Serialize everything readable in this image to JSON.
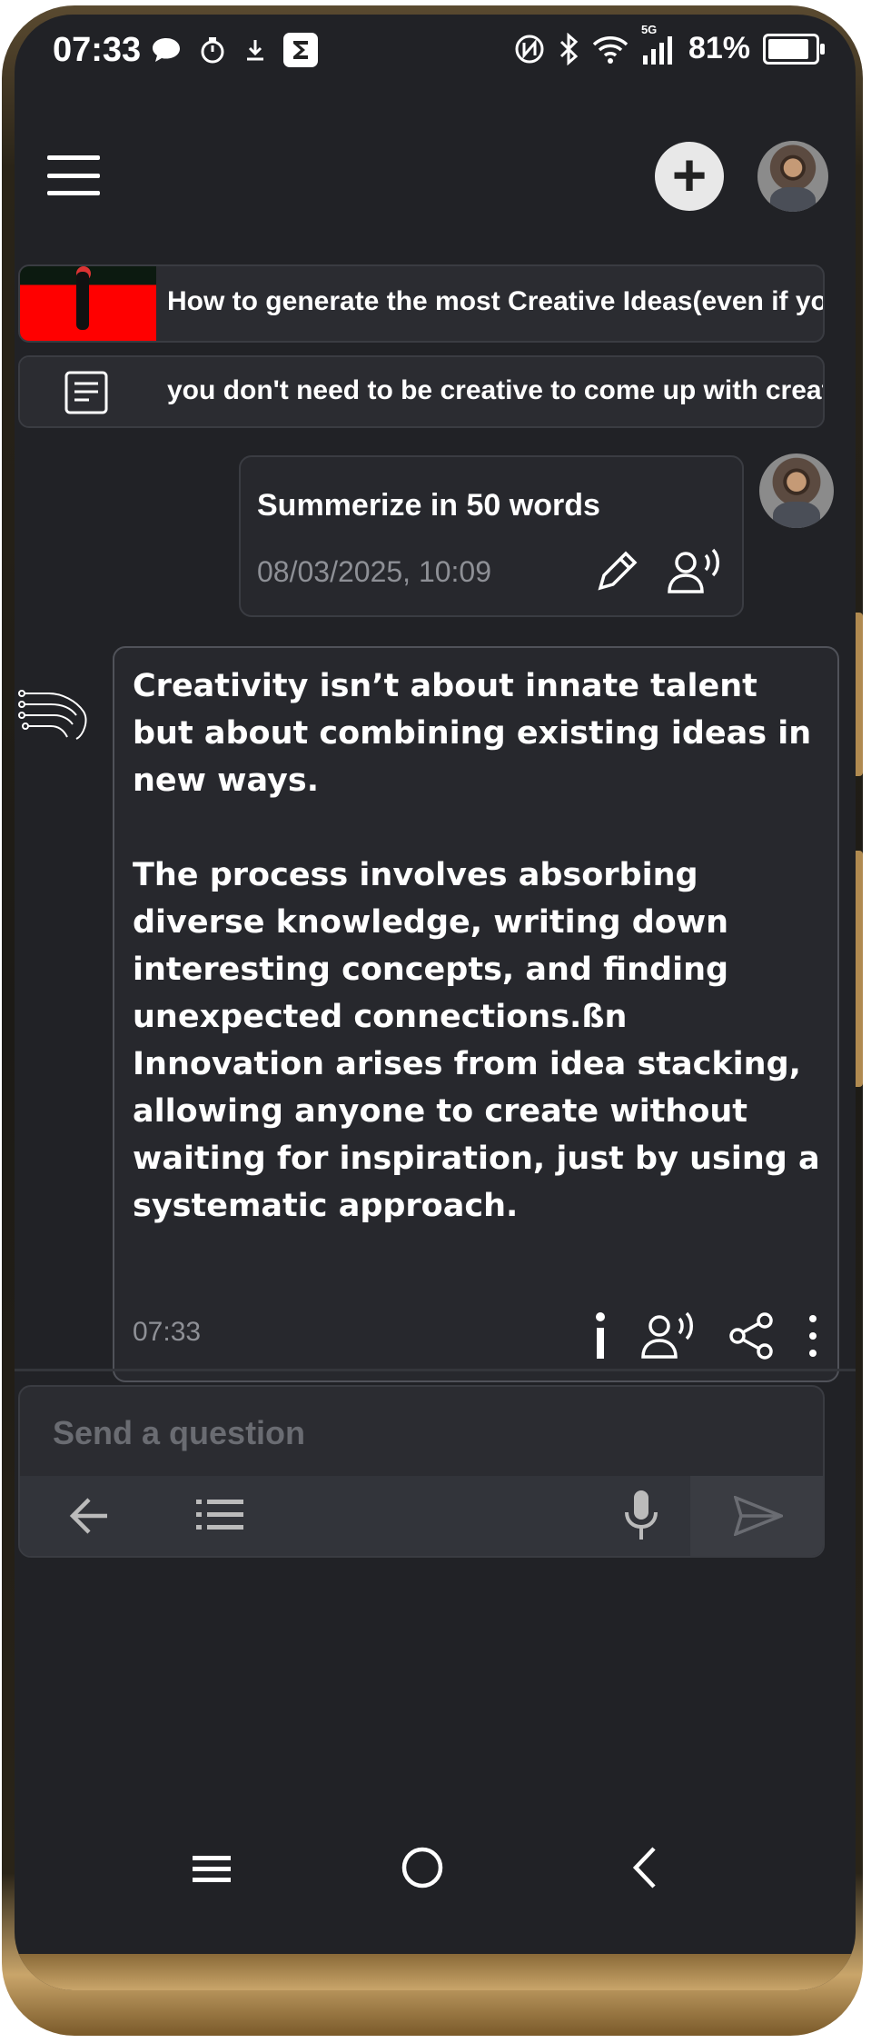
{
  "status_bar": {
    "time": "07:33",
    "network": "5G",
    "battery_percent": "81%"
  },
  "sources": [
    {
      "title": "How to generate the most Creative Ideas(even if you are no"
    },
    {
      "title": "you don't need to be creative to come up with creative ideas"
    }
  ],
  "user_message": {
    "text": "Summerize in 50 words",
    "timestamp": "08/03/2025, 10:09"
  },
  "bot_message": {
    "text": "Creativity isn’t about innate talent but about combining existing ideas in new ways.\n\nThe process involves absorbing diverse knowledge, writing down interesting concepts, and finding unexpected connections.ßn\nInnovation arises from idea stacking, allowing anyone to create without waiting for inspiration, just by using a systematic approach.",
    "time": "07:33"
  },
  "composer": {
    "placeholder": "Send a question"
  },
  "icons": {
    "menu": "hamburger-icon",
    "add": "plus-icon",
    "edit": "pencil-icon",
    "speak": "speaker-person-icon",
    "info": "info-icon",
    "share": "share-icon",
    "more": "more-vertical-icon",
    "back": "arrow-left-icon",
    "list": "list-icon",
    "mic": "microphone-icon",
    "send": "send-icon"
  },
  "colors": {
    "background": "#212226",
    "card": "#27282d",
    "accent_gold": "#c9a56a"
  }
}
